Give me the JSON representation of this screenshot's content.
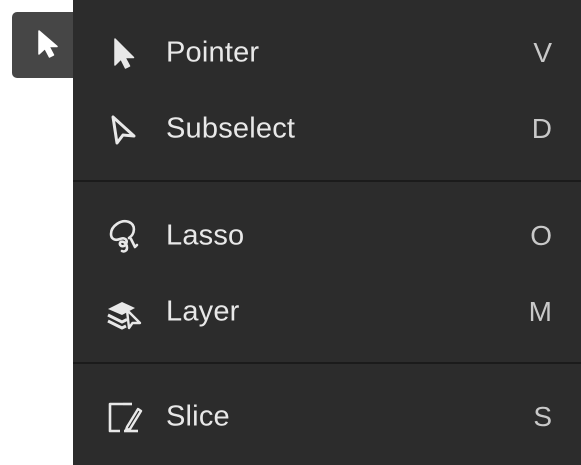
{
  "active_tool": {
    "icon": "pointer-arrow-icon"
  },
  "menu": {
    "groups": [
      {
        "items": [
          {
            "label": "Pointer",
            "shortcut": "V",
            "icon": "pointer-arrow-icon"
          },
          {
            "label": "Subselect",
            "shortcut": "D",
            "icon": "subselect-arrow-icon"
          }
        ]
      },
      {
        "items": [
          {
            "label": "Lasso",
            "shortcut": "O",
            "icon": "lasso-icon"
          },
          {
            "label": "Layer",
            "shortcut": "M",
            "icon": "layer-select-icon"
          }
        ]
      },
      {
        "items": [
          {
            "label": "Slice",
            "shortcut": "S",
            "icon": "slice-icon"
          }
        ]
      }
    ]
  },
  "colors": {
    "menu_background": "#2c2c2c",
    "tool_button_background": "#464646",
    "text": "#e8e8e8",
    "divider": "#1b1b1b"
  }
}
